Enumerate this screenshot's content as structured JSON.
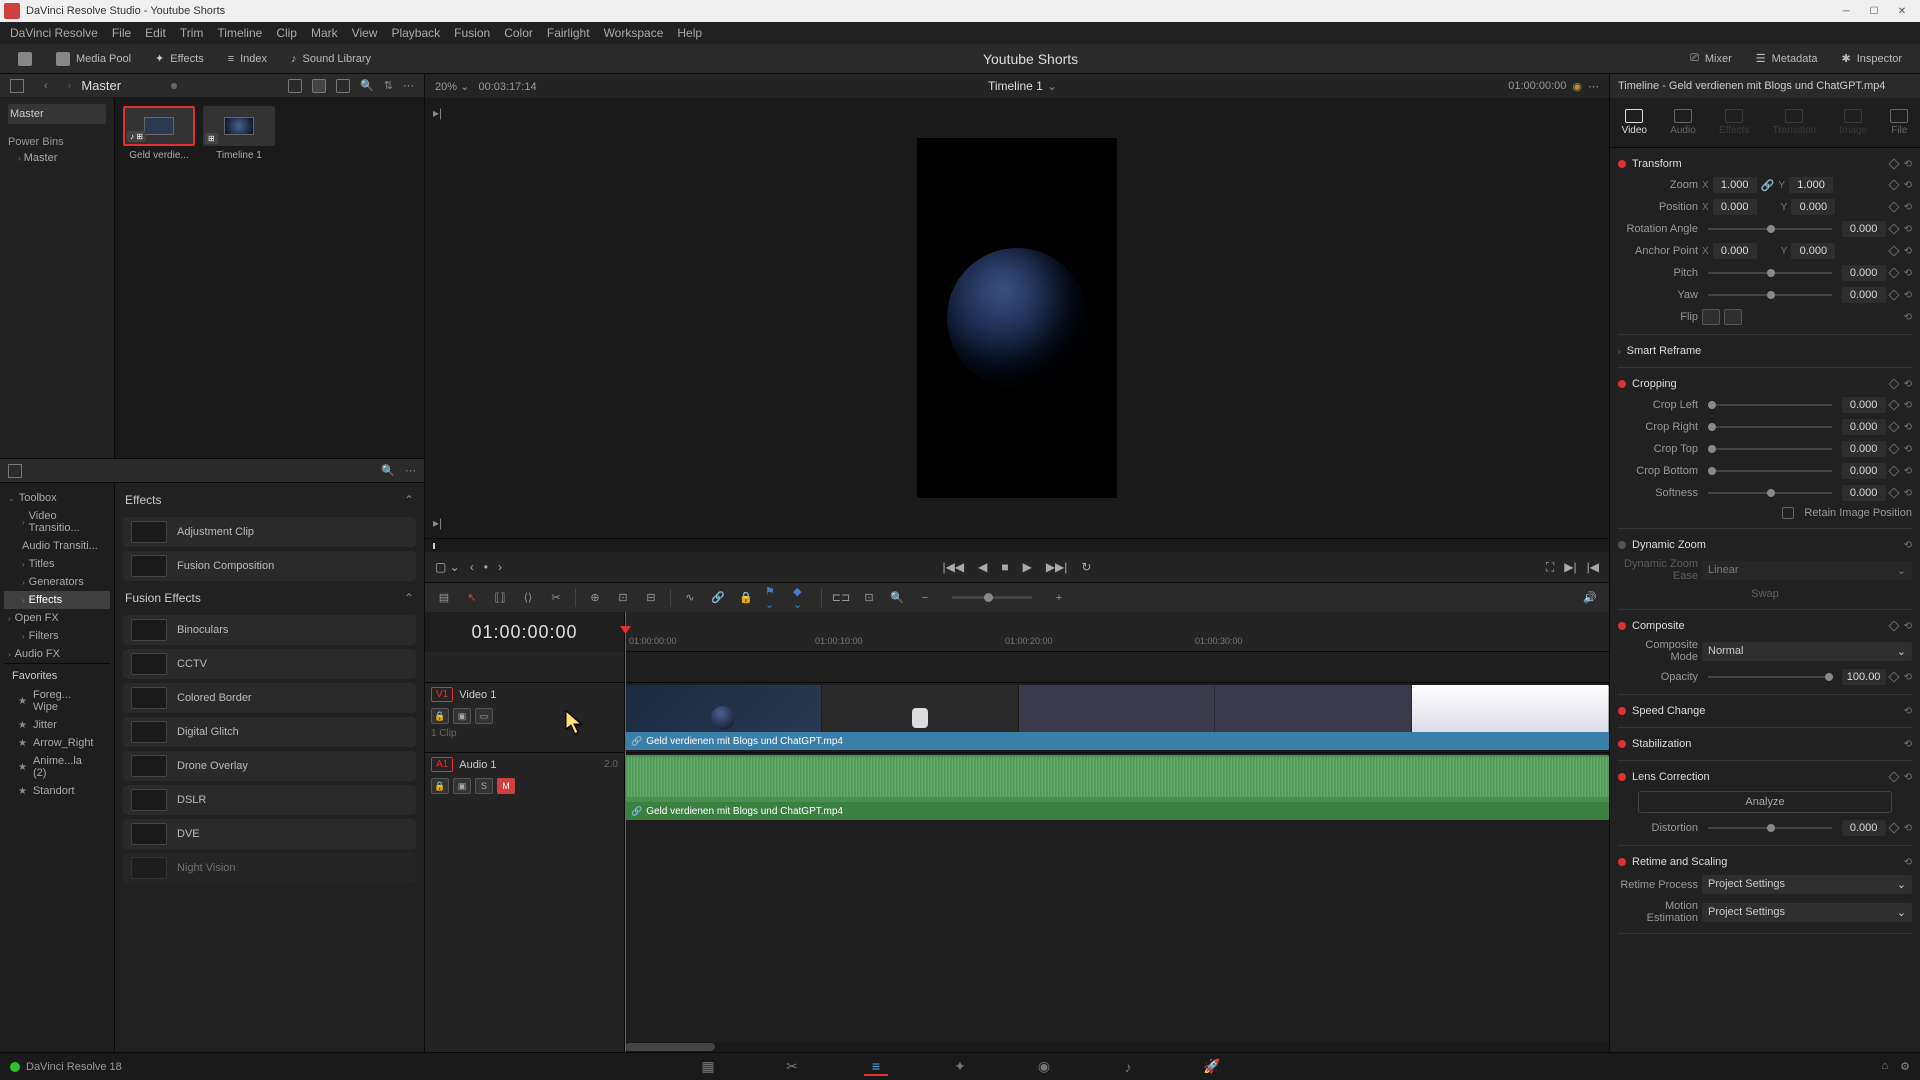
{
  "window": {
    "title": "DaVinci Resolve Studio - Youtube Shorts"
  },
  "menu": [
    "DaVinci Resolve",
    "File",
    "Edit",
    "Trim",
    "Timeline",
    "Clip",
    "Mark",
    "View",
    "Playback",
    "Fusion",
    "Color",
    "Fairlight",
    "Workspace",
    "Help"
  ],
  "toolbar": {
    "media_pool": "Media Pool",
    "effects": "Effects",
    "index": "Index",
    "sound_library": "Sound Library",
    "project": "Youtube Shorts",
    "mixer": "Mixer",
    "metadata": "Metadata",
    "inspector": "Inspector"
  },
  "media": {
    "master": "Master",
    "power_bins": "Power Bins",
    "power_bin_sub": "Master",
    "clips": [
      {
        "name": "Geld verdie...",
        "badges": "♪ ⊞",
        "selected": true
      },
      {
        "name": "Timeline 1",
        "badges": "⊞",
        "selected": false
      }
    ]
  },
  "viewer": {
    "zoom": "20%",
    "source_tc": "00:03:17:14",
    "timeline_name": "Timeline 1",
    "record_tc": "01:00:00:00"
  },
  "fx_tree": {
    "toolbox": "Toolbox",
    "video_trans": "Video Transitio...",
    "audio_trans": "Audio Transiti...",
    "titles": "Titles",
    "generators": "Generators",
    "effects": "Effects",
    "open_fx": "Open FX",
    "filters": "Filters",
    "audio_fx": "Audio FX"
  },
  "fx_list": {
    "effects_header": "Effects",
    "adjustment_clip": "Adjustment Clip",
    "fusion_composition": "Fusion Composition",
    "fusion_effects_header": "Fusion Effects",
    "items": [
      "Binoculars",
      "CCTV",
      "Colored Border",
      "Digital Glitch",
      "Drone Overlay",
      "DSLR",
      "DVE",
      "Night Vision"
    ]
  },
  "favorites": {
    "header": "Favorites",
    "items": [
      "Foreg... Wipe",
      "Jitter",
      "Arrow_Right",
      "Anime...la (2)",
      "Standort"
    ]
  },
  "timeline": {
    "tc": "01:00:00:00",
    "ruler": [
      "01:00:00:00",
      "01:00:10:00",
      "01:00:20:00",
      "01:00:30:00"
    ],
    "video_track": {
      "badge": "V1",
      "name": "Video 1",
      "clip_count": "1 Clip"
    },
    "audio_track": {
      "badge": "A1",
      "name": "Audio 1",
      "db": "2.0",
      "solo": "S",
      "mute": "M"
    },
    "clip_name": "Geld verdienen mit Blogs und ChatGPT.mp4"
  },
  "inspector": {
    "header": "Timeline - Geld verdienen mit Blogs und ChatGPT.mp4",
    "tabs": [
      "Video",
      "Audio",
      "Effects",
      "Transition",
      "Image",
      "File"
    ],
    "transform": {
      "title": "Transform",
      "zoom_lbl": "Zoom",
      "zoom_x": "1.000",
      "zoom_y": "1.000",
      "position_lbl": "Position",
      "pos_x": "0.000",
      "pos_y": "0.000",
      "rotation_lbl": "Rotation Angle",
      "rotation": "0.000",
      "anchor_lbl": "Anchor Point",
      "anchor_x": "0.000",
      "anchor_y": "0.000",
      "pitch_lbl": "Pitch",
      "pitch": "0.000",
      "yaw_lbl": "Yaw",
      "yaw": "0.000",
      "flip_lbl": "Flip"
    },
    "smart_reframe": "Smart Reframe",
    "cropping": {
      "title": "Cropping",
      "left_lbl": "Crop Left",
      "left": "0.000",
      "right_lbl": "Crop Right",
      "right": "0.000",
      "top_lbl": "Crop Top",
      "top": "0.000",
      "bottom_lbl": "Crop Bottom",
      "bottom": "0.000",
      "softness_lbl": "Softness",
      "softness": "0.000",
      "retain_lbl": "Retain Image Position"
    },
    "dynamic_zoom": {
      "title": "Dynamic Zoom",
      "ease_lbl": "Dynamic Zoom Ease",
      "ease": "Linear",
      "swap": "Swap"
    },
    "composite": {
      "title": "Composite",
      "mode_lbl": "Composite Mode",
      "mode": "Normal",
      "opacity_lbl": "Opacity",
      "opacity": "100.00"
    },
    "speed": "Speed Change",
    "stabilization": "Stabilization",
    "lens": {
      "title": "Lens Correction",
      "analyze": "Analyze",
      "distortion_lbl": "Distortion",
      "distortion": "0.000"
    },
    "retime": {
      "title": "Retime and Scaling",
      "process_lbl": "Retime Process",
      "process": "Project Settings",
      "motion_lbl": "Motion Estimation",
      "motion": "Project Settings"
    }
  },
  "footer": {
    "version": "DaVinci Resolve 18"
  }
}
